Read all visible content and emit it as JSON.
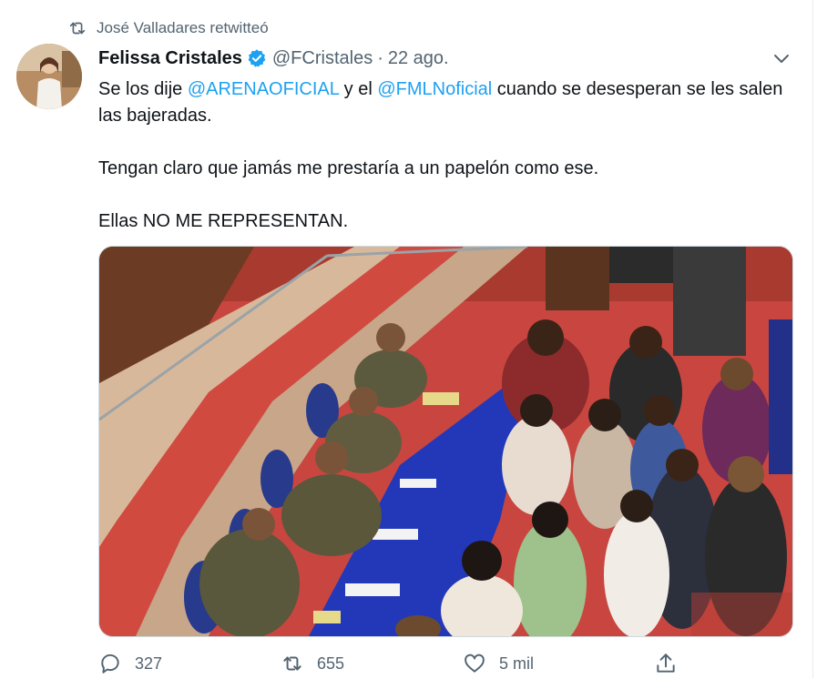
{
  "retweet_banner": {
    "text": "José Valladares retwitteó"
  },
  "tweet": {
    "author_name": "Felissa Cristales",
    "handle": "@FCristales",
    "separator": "·",
    "date": "22 ago.",
    "text": {
      "line1_prefix": "Se los dije ",
      "mention1": "@ARENAOFICIAL",
      "line1_mid": " y el ",
      "mention2": "@FMLNoficial",
      "line1_suffix": " cuando se desesperan se les salen las bajeradas.",
      "paragraph2": "Tengan claro que jamás me prestaría a un papelón como ese.",
      "paragraph3": "Ellas NO ME REPRESENTAN."
    },
    "actions": {
      "reply_count": "327",
      "retweet_count": "655",
      "like_count": "5 mil"
    }
  },
  "icons": {
    "retweet": "retweet-icon",
    "verified": "verified-badge-icon",
    "caret": "chevron-down-icon",
    "reply": "reply-icon",
    "like": "heart-icon",
    "share": "share-icon"
  },
  "colors": {
    "link": "#1da1f2",
    "secondary_text": "#536471",
    "primary_text": "#0f1419",
    "verified": "#1da1f2"
  }
}
